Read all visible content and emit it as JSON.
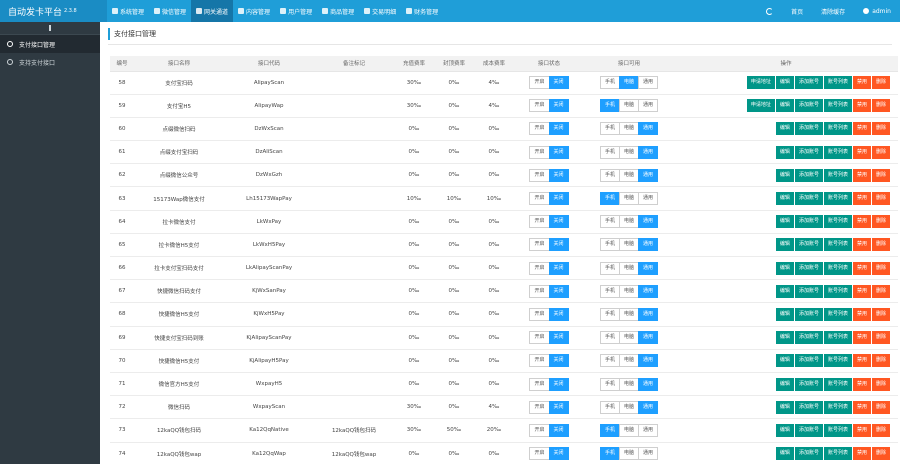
{
  "brand": {
    "title": "自动发卡平台",
    "version": "2.3.8"
  },
  "topnav": [
    {
      "label": "系统管理",
      "icon": "gear-icon",
      "active": false
    },
    {
      "label": "微信管理",
      "icon": "chat-icon",
      "active": false
    },
    {
      "label": "网关通道",
      "icon": "globe-icon",
      "active": true
    },
    {
      "label": "内容管理",
      "icon": "document-icon",
      "active": false
    },
    {
      "label": "用户管理",
      "icon": "users-icon",
      "active": false
    },
    {
      "label": "商品管理",
      "icon": "box-icon",
      "active": false
    },
    {
      "label": "交易明细",
      "icon": "chart-icon",
      "active": false
    },
    {
      "label": "财务管理",
      "icon": "wallet-icon",
      "active": false
    }
  ],
  "topright": {
    "home": "首页",
    "clear_cache": "清除缓存",
    "user": "admin"
  },
  "sidebar": [
    {
      "label": "支付接口管理",
      "active": true
    },
    {
      "label": "支持支付接口",
      "active": false
    }
  ],
  "page_title": "支付接口管理",
  "columns": [
    "编号",
    "接口名称",
    "接口代码",
    "备注标记",
    "充值费率",
    "封顶费率",
    "成本费率",
    "接口状态",
    "接口可用",
    "操作"
  ],
  "toggle_labels": {
    "open": "开启",
    "close": "关闭",
    "mobile": "手机",
    "pc": "电脑",
    "common": "通用"
  },
  "op_labels": {
    "apply": "申请地址",
    "edit": "编辑",
    "add_account": "添加账号",
    "account_list": "账号列表",
    "disable": "禁用",
    "delete": "删除"
  },
  "rows": [
    {
      "id": "58",
      "name": "支付宝扫码",
      "code": "AlipayScan",
      "note": "",
      "rate": "30‰",
      "cap": "0‰",
      "cost": "4‰",
      "avail": "pc",
      "apply": true
    },
    {
      "id": "59",
      "name": "支付宝H5",
      "code": "AlipayWap",
      "note": "",
      "rate": "30‰",
      "cap": "0‰",
      "cost": "4‰",
      "avail": "mobile",
      "apply": true
    },
    {
      "id": "60",
      "name": "点缀微信扫码",
      "code": "DzWxScan",
      "note": "",
      "rate": "0‰",
      "cap": "0‰",
      "cost": "0‰",
      "avail": "common",
      "apply": false
    },
    {
      "id": "61",
      "name": "点缀支付宝扫码",
      "code": "DzAliScan",
      "note": "",
      "rate": "0‰",
      "cap": "0‰",
      "cost": "0‰",
      "avail": "common",
      "apply": false
    },
    {
      "id": "62",
      "name": "点缀微信公众号",
      "code": "DzWxGzh",
      "note": "",
      "rate": "0‰",
      "cap": "0‰",
      "cost": "0‰",
      "avail": "common",
      "apply": false
    },
    {
      "id": "63",
      "name": "15173Wap微信支付",
      "code": "Lh15173WapPay",
      "note": "",
      "rate": "10‰",
      "cap": "10‰",
      "cost": "10‰",
      "avail": "mobile",
      "apply": false
    },
    {
      "id": "64",
      "name": "拉卡微信支付",
      "code": "LkWxPay",
      "note": "",
      "rate": "0‰",
      "cap": "0‰",
      "cost": "0‰",
      "avail": "common",
      "apply": false
    },
    {
      "id": "65",
      "name": "拉卡微信H5支付",
      "code": "LkWxH5Pay",
      "note": "",
      "rate": "0‰",
      "cap": "0‰",
      "cost": "0‰",
      "avail": "common",
      "apply": false
    },
    {
      "id": "66",
      "name": "拉卡支付宝扫码支付",
      "code": "LkAlipayScanPay",
      "note": "",
      "rate": "0‰",
      "cap": "0‰",
      "cost": "0‰",
      "avail": "common",
      "apply": false
    },
    {
      "id": "67",
      "name": "快捷微信扫码支付",
      "code": "KjWxSanPay",
      "note": "",
      "rate": "0‰",
      "cap": "0‰",
      "cost": "0‰",
      "avail": "common",
      "apply": false
    },
    {
      "id": "68",
      "name": "快捷微信H5支付",
      "code": "KjWxH5Pay",
      "note": "",
      "rate": "0‰",
      "cap": "0‰",
      "cost": "0‰",
      "avail": "common",
      "apply": false
    },
    {
      "id": "69",
      "name": "快捷支付宝扫码到账",
      "code": "KjAlipayScanPay",
      "note": "",
      "rate": "0‰",
      "cap": "0‰",
      "cost": "0‰",
      "avail": "common",
      "apply": false
    },
    {
      "id": "70",
      "name": "快捷微信H5支付",
      "code": "KjAlipayH5Pay",
      "note": "",
      "rate": "0‰",
      "cap": "0‰",
      "cost": "0‰",
      "avail": "common",
      "apply": false
    },
    {
      "id": "71",
      "name": "微信官方H5支付",
      "code": "WxpayH5",
      "note": "",
      "rate": "0‰",
      "cap": "0‰",
      "cost": "0‰",
      "avail": "common",
      "apply": false
    },
    {
      "id": "72",
      "name": "微信扫码",
      "code": "WxpayScan",
      "note": "",
      "rate": "30‰",
      "cap": "0‰",
      "cost": "4‰",
      "avail": "common",
      "apply": false
    },
    {
      "id": "73",
      "name": "12kaQQ钱包扫码",
      "code": "Ka12QqNative",
      "note": "12kaQQ钱包扫码",
      "rate": "30‰",
      "cap": "50‰",
      "cost": "20‰",
      "avail": "mobile",
      "apply": false
    },
    {
      "id": "74",
      "name": "12kaQQ钱包wap",
      "code": "Ka12QqWap",
      "note": "12kaQQ钱包wap",
      "rate": "0‰",
      "cap": "0‰",
      "cost": "0‰",
      "avail": "mobile",
      "apply": false
    }
  ],
  "colors": {
    "topbar": "#1f9ed8",
    "sidebar": "#2f3a42",
    "primary": "#1e9fff",
    "green": "#009688",
    "orange": "#ff5722"
  }
}
